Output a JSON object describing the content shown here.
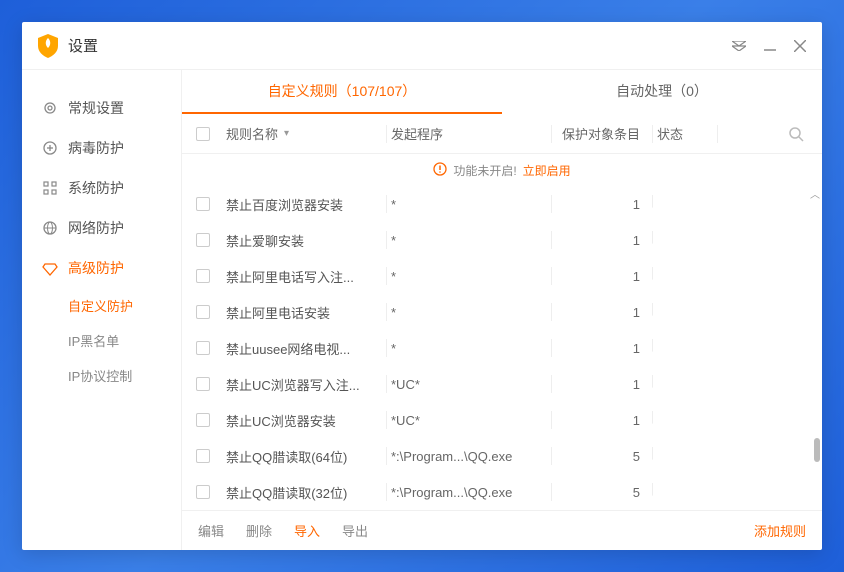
{
  "titlebar": {
    "title": "设置"
  },
  "sidebar": {
    "items": [
      {
        "label": "常规设置"
      },
      {
        "label": "病毒防护"
      },
      {
        "label": "系统防护"
      },
      {
        "label": "网络防护"
      },
      {
        "label": "高级防护"
      }
    ],
    "sub": [
      {
        "label": "自定义防护"
      },
      {
        "label": "IP黑名单"
      },
      {
        "label": "IP协议控制"
      }
    ]
  },
  "tabs": {
    "custom": "自定义规则（107/107）",
    "auto": "自动处理（0）"
  },
  "header": {
    "name": "规则名称",
    "proc": "发起程序",
    "obj": "保护对象条目",
    "state": "状态"
  },
  "banner": {
    "msg": "功能未开启!",
    "link": "立即启用"
  },
  "rows": [
    {
      "name": "禁止百度浏览器安装",
      "proc": "*",
      "obj": "1"
    },
    {
      "name": "禁止爱聊安装",
      "proc": "*",
      "obj": "1"
    },
    {
      "name": "禁止阿里电话写入注...",
      "proc": "*",
      "obj": "1"
    },
    {
      "name": "禁止阿里电话安装",
      "proc": "*",
      "obj": "1"
    },
    {
      "name": "禁止uusee网络电视...",
      "proc": "*",
      "obj": "1"
    },
    {
      "name": "禁止UC浏览器写入注...",
      "proc": "*UC*",
      "obj": "1"
    },
    {
      "name": "禁止UC浏览器安装",
      "proc": "*UC*",
      "obj": "1"
    },
    {
      "name": "禁止QQ腊读取(64位)",
      "proc": "*:\\Program...\\QQ.exe",
      "obj": "5"
    },
    {
      "name": "禁止QQ腊读取(32位)",
      "proc": "*:\\Program...\\QQ.exe",
      "obj": "5"
    }
  ],
  "footer": {
    "edit": "编辑",
    "delete": "删除",
    "import": "导入",
    "export": "导出",
    "add": "添加规则"
  }
}
